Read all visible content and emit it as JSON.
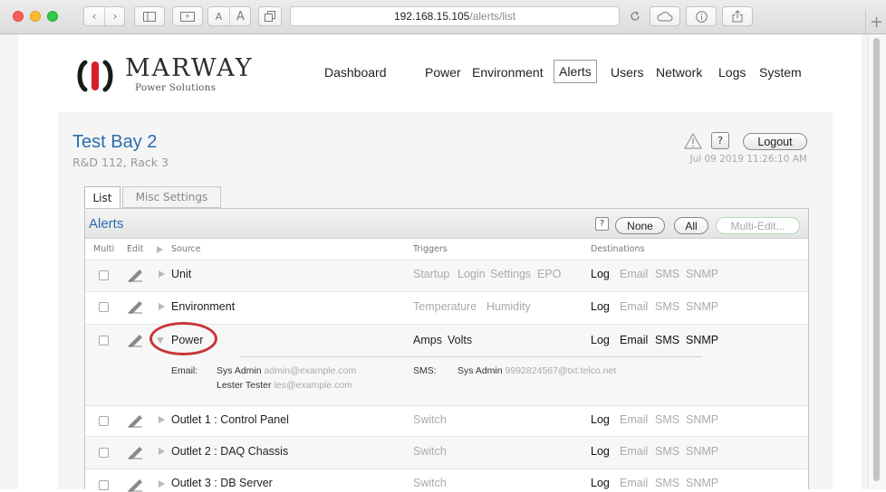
{
  "browser": {
    "url_host": "192.168.15.105",
    "url_path": "/alerts/list",
    "font_small": "A",
    "font_large": "A"
  },
  "brand": {
    "name": "MARWAY",
    "tagline": "Power Solutions",
    "logo_color": "#d61f26",
    "logo_dark": "#1a1a1a"
  },
  "nav": {
    "items": [
      "Dashboard",
      "Power",
      "Environment",
      "Alerts",
      "Users",
      "Network",
      "Logs",
      "System"
    ],
    "active": "Alerts"
  },
  "header": {
    "title": "Test Bay 2",
    "subtitle": "R&D 112, Rack 3",
    "help_label": "?",
    "logout_label": "Logout",
    "timestamp": "Jul 09 2019 11:26:10 AM"
  },
  "tabs": {
    "list": "List",
    "misc": "Misc Settings"
  },
  "alerts_panel": {
    "title": "Alerts",
    "help_label": "?",
    "none_label": "None",
    "all_label": "All",
    "multi_edit_label": "Multi-Edit...",
    "columns": {
      "multi": "Multi",
      "edit": "Edit",
      "source": "Source",
      "triggers": "Triggers",
      "destinations": "Destinations"
    },
    "rows": [
      {
        "source": "Unit",
        "triggers": [
          "Startup",
          "Login",
          "Settings",
          "EPO"
        ],
        "triggers_active": false,
        "destinations": [
          "Log",
          "Email",
          "SMS",
          "SNMP"
        ],
        "destinations_active": [
          "Log"
        ]
      },
      {
        "source": "Environment",
        "triggers": [
          "Temperature",
          "Humidity"
        ],
        "triggers_active": false,
        "destinations": [
          "Log",
          "Email",
          "SMS",
          "SNMP"
        ],
        "destinations_active": [
          "Log"
        ]
      },
      {
        "source": "Power",
        "triggers": [
          "Amps",
          "Volts"
        ],
        "triggers_active": true,
        "destinations": [
          "Log",
          "Email",
          "SMS",
          "SNMP"
        ],
        "destinations_active": [
          "Log",
          "Email",
          "SMS",
          "SNMP"
        ],
        "expanded": true,
        "detail": {
          "email_label": "Email:",
          "email_recipients": [
            {
              "name": "Sys Admin",
              "address": "admin@example.com"
            },
            {
              "name": "Lester Tester",
              "address": "les@example.com"
            }
          ],
          "sms_label": "SMS:",
          "sms_recipients": [
            {
              "name": "Sys Admin",
              "address": "9992824567@txt.telco.net"
            }
          ]
        }
      },
      {
        "source": "Outlet 1 : Control Panel",
        "triggers": [
          "Switch"
        ],
        "triggers_active": false,
        "destinations": [
          "Log",
          "Email",
          "SMS",
          "SNMP"
        ],
        "destinations_active": [
          "Log"
        ]
      },
      {
        "source": "Outlet 2 : DAQ Chassis",
        "triggers": [
          "Switch"
        ],
        "triggers_active": false,
        "destinations": [
          "Log",
          "Email",
          "SMS",
          "SNMP"
        ],
        "destinations_active": [
          "Log"
        ]
      },
      {
        "source": "Outlet 3 : DB Server",
        "triggers": [
          "Switch"
        ],
        "triggers_active": false,
        "destinations": [
          "Log",
          "Email",
          "SMS",
          "SNMP"
        ],
        "destinations_active": [
          "Log"
        ]
      }
    ]
  },
  "annotation": {
    "highlight_color": "#c8363a"
  }
}
